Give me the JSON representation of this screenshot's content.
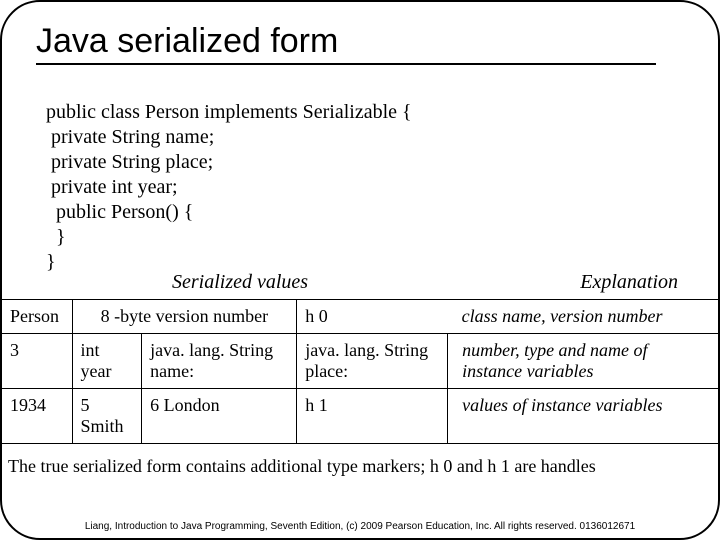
{
  "title": "Java serialized form",
  "code": {
    "l1": "public class Person implements Serializable {",
    "l2": " private String name;",
    "l3": " private String place;",
    "l4": " private int year;",
    "l5": "  public Person() {",
    "l6": "  }",
    "l7": "}"
  },
  "labels": {
    "serialized": "Serialized values",
    "explanation": "Explanation"
  },
  "table": {
    "r1": {
      "c1": "Person",
      "c2_span": "8 -byte version number",
      "c4": "h 0",
      "explain": "class name, version number"
    },
    "r2": {
      "c1": "3",
      "c2": "int year",
      "c3": "java. lang. String name:",
      "c4": "java. lang. String place:",
      "explain": "number, type and name of instance variables"
    },
    "r3": {
      "c1": "1934",
      "c2": "5 Smith",
      "c3": "6 London",
      "c4": "h 1",
      "explain": "values of instance variables"
    }
  },
  "note": "The true serialized form contains additional type markers; h 0 and h 1 are handles",
  "footer": "Liang, Introduction to Java Programming, Seventh Edition, (c) 2009 Pearson Education, Inc. All rights reserved. 0136012671"
}
